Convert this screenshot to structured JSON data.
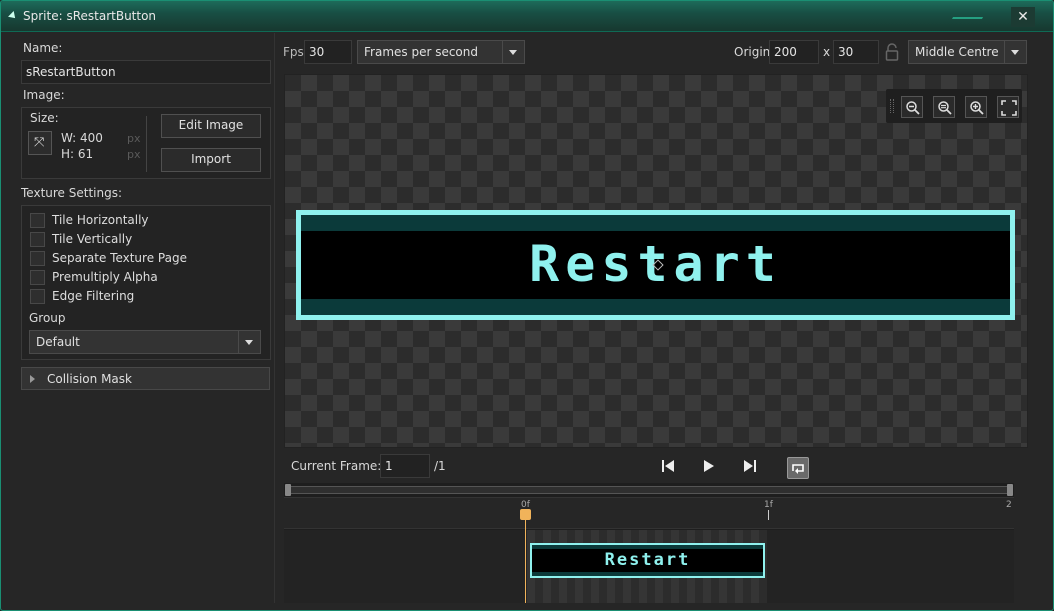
{
  "window": {
    "title": "Sprite: sRestartButton",
    "close_glyph": "✕"
  },
  "left": {
    "name_label": "Name:",
    "name_value": "sRestartButton",
    "image_label": "Image:",
    "size_label": "Size:",
    "width_text": "W: 400",
    "height_text": "H: 61",
    "unit": "px",
    "edit_image": "Edit Image",
    "import": "Import",
    "texture_label": "Texture Settings:",
    "checkboxes": [
      {
        "label": "Tile Horizontally",
        "checked": false
      },
      {
        "label": "Tile Vertically",
        "checked": false
      },
      {
        "label": "Separate Texture Page",
        "checked": false
      },
      {
        "label": "Premultiply Alpha",
        "checked": false
      },
      {
        "label": "Edge Filtering",
        "checked": false
      }
    ],
    "group_label": "Group",
    "group_value": "Default",
    "collision_mask": "Collision Mask"
  },
  "toolbar": {
    "fps_label": "Fps",
    "fps_value": "30",
    "fps_mode": "Frames per second",
    "origin_label": "Origin",
    "origin_x": "200",
    "origin_sep": "x",
    "origin_y": "30",
    "origin_preset": "Middle Centre"
  },
  "canvas": {
    "sprite_text": "Restart"
  },
  "frame": {
    "label": "Current Frame:",
    "value": "1",
    "total": "/1"
  },
  "timeline": {
    "ticks": [
      "0f",
      "1f",
      "2"
    ],
    "thumb_text": "Restart"
  },
  "colors": {
    "accent": "#1a8f73",
    "sprite_cyan": "#8ff1ee",
    "playhead": "#f1b35a"
  }
}
